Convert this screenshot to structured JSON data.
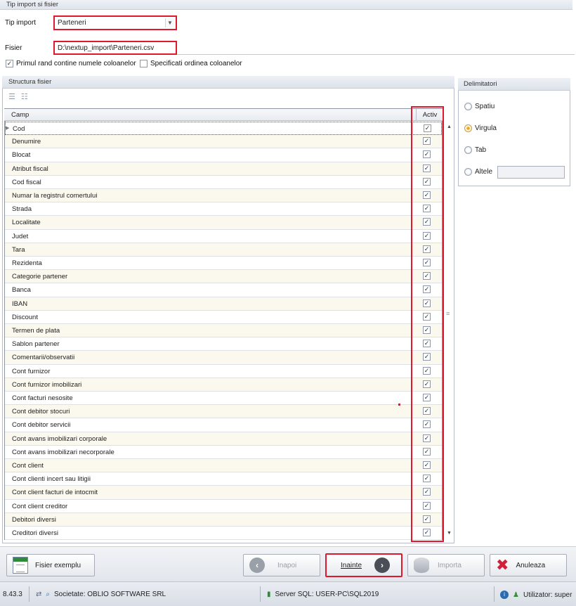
{
  "import": {
    "section_title": "Tip import si fisier",
    "tip_import_label": "Tip import",
    "tip_import_value": "Parteneri",
    "fisier_label": "Fisier",
    "fisier_value": "D:\\nextup_import\\Parteneri.csv",
    "first_row_names_label": "Primul rand contine numele coloanelor",
    "first_row_names_checked": true,
    "specify_order_label": "Specificati ordinea coloanelor",
    "specify_order_checked": false
  },
  "structure": {
    "title": "Structura fisier",
    "columns": {
      "camp": "Camp",
      "activ": "Activ"
    },
    "rows": [
      {
        "camp": "Cod",
        "activ": true
      },
      {
        "camp": "Denumire",
        "activ": true
      },
      {
        "camp": "Blocat",
        "activ": true
      },
      {
        "camp": "Atribut fiscal",
        "activ": true
      },
      {
        "camp": "Cod fiscal",
        "activ": true
      },
      {
        "camp": "Numar la registrul comertului",
        "activ": true
      },
      {
        "camp": "Strada",
        "activ": true
      },
      {
        "camp": "Localitate",
        "activ": true
      },
      {
        "camp": "Judet",
        "activ": true
      },
      {
        "camp": "Tara",
        "activ": true
      },
      {
        "camp": "Rezidenta",
        "activ": true
      },
      {
        "camp": "Categorie partener",
        "activ": true
      },
      {
        "camp": "Banca",
        "activ": true
      },
      {
        "camp": "IBAN",
        "activ": true
      },
      {
        "camp": "Discount",
        "activ": true
      },
      {
        "camp": "Termen de plata",
        "activ": true
      },
      {
        "camp": "Sablon partener",
        "activ": true
      },
      {
        "camp": "Comentarii/observatii",
        "activ": true
      },
      {
        "camp": "Cont furnizor",
        "activ": true
      },
      {
        "camp": "Cont furnizor imobilizari",
        "activ": true
      },
      {
        "camp": "Cont facturi nesosite",
        "activ": true
      },
      {
        "camp": "Cont debitor stocuri",
        "activ": true
      },
      {
        "camp": "Cont debitor servicii",
        "activ": true
      },
      {
        "camp": "Cont avans imobilizari corporale",
        "activ": true
      },
      {
        "camp": "Cont avans imobilizari necorporale",
        "activ": true
      },
      {
        "camp": "Cont client",
        "activ": true
      },
      {
        "camp": "Cont clienti incert sau litigii",
        "activ": true
      },
      {
        "camp": "Cont client facturi de intocmit",
        "activ": true
      },
      {
        "camp": "Cont client creditor",
        "activ": true
      },
      {
        "camp": "Debitori diversi",
        "activ": true
      },
      {
        "camp": "Creditori diversi",
        "activ": true
      }
    ]
  },
  "delimiters": {
    "title": "Delimitatori",
    "options": [
      "Spatiu",
      "Virgula",
      "Tab",
      "Altele"
    ],
    "selected": "Virgula",
    "altele_value": ""
  },
  "buttons": {
    "fisier_exemplu": "Fisier exemplu",
    "inapoi": "Inapoi",
    "inainte": "Inainte",
    "importa": "Importa",
    "anuleaza": "Anuleaza"
  },
  "status": {
    "version": "8.43.3",
    "societate": "Societate: OBLIO SOFTWARE SRL",
    "server": "Server SQL: USER-PC\\SQL2019",
    "utilizator": "Utilizator: super"
  },
  "colors": {
    "highlight": "#e0182d",
    "row_alt": "#fbf8ee",
    "nav_circle": "#4a4f57",
    "radio_selected": "#f2a516"
  }
}
